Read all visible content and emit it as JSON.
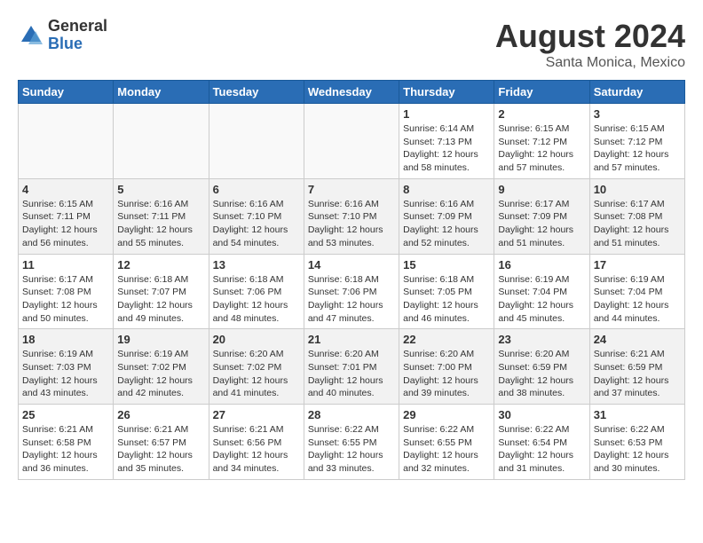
{
  "header": {
    "logo_general": "General",
    "logo_blue": "Blue",
    "title": "August 2024",
    "location": "Santa Monica, Mexico"
  },
  "days_of_week": [
    "Sunday",
    "Monday",
    "Tuesday",
    "Wednesday",
    "Thursday",
    "Friday",
    "Saturday"
  ],
  "weeks": [
    [
      {
        "day": "",
        "text": ""
      },
      {
        "day": "",
        "text": ""
      },
      {
        "day": "",
        "text": ""
      },
      {
        "day": "",
        "text": ""
      },
      {
        "day": "1",
        "text": "Sunrise: 6:14 AM\nSunset: 7:13 PM\nDaylight: 12 hours\nand 58 minutes."
      },
      {
        "day": "2",
        "text": "Sunrise: 6:15 AM\nSunset: 7:12 PM\nDaylight: 12 hours\nand 57 minutes."
      },
      {
        "day": "3",
        "text": "Sunrise: 6:15 AM\nSunset: 7:12 PM\nDaylight: 12 hours\nand 57 minutes."
      }
    ],
    [
      {
        "day": "4",
        "text": "Sunrise: 6:15 AM\nSunset: 7:11 PM\nDaylight: 12 hours\nand 56 minutes."
      },
      {
        "day": "5",
        "text": "Sunrise: 6:16 AM\nSunset: 7:11 PM\nDaylight: 12 hours\nand 55 minutes."
      },
      {
        "day": "6",
        "text": "Sunrise: 6:16 AM\nSunset: 7:10 PM\nDaylight: 12 hours\nand 54 minutes."
      },
      {
        "day": "7",
        "text": "Sunrise: 6:16 AM\nSunset: 7:10 PM\nDaylight: 12 hours\nand 53 minutes."
      },
      {
        "day": "8",
        "text": "Sunrise: 6:16 AM\nSunset: 7:09 PM\nDaylight: 12 hours\nand 52 minutes."
      },
      {
        "day": "9",
        "text": "Sunrise: 6:17 AM\nSunset: 7:09 PM\nDaylight: 12 hours\nand 51 minutes."
      },
      {
        "day": "10",
        "text": "Sunrise: 6:17 AM\nSunset: 7:08 PM\nDaylight: 12 hours\nand 51 minutes."
      }
    ],
    [
      {
        "day": "11",
        "text": "Sunrise: 6:17 AM\nSunset: 7:08 PM\nDaylight: 12 hours\nand 50 minutes."
      },
      {
        "day": "12",
        "text": "Sunrise: 6:18 AM\nSunset: 7:07 PM\nDaylight: 12 hours\nand 49 minutes."
      },
      {
        "day": "13",
        "text": "Sunrise: 6:18 AM\nSunset: 7:06 PM\nDaylight: 12 hours\nand 48 minutes."
      },
      {
        "day": "14",
        "text": "Sunrise: 6:18 AM\nSunset: 7:06 PM\nDaylight: 12 hours\nand 47 minutes."
      },
      {
        "day": "15",
        "text": "Sunrise: 6:18 AM\nSunset: 7:05 PM\nDaylight: 12 hours\nand 46 minutes."
      },
      {
        "day": "16",
        "text": "Sunrise: 6:19 AM\nSunset: 7:04 PM\nDaylight: 12 hours\nand 45 minutes."
      },
      {
        "day": "17",
        "text": "Sunrise: 6:19 AM\nSunset: 7:04 PM\nDaylight: 12 hours\nand 44 minutes."
      }
    ],
    [
      {
        "day": "18",
        "text": "Sunrise: 6:19 AM\nSunset: 7:03 PM\nDaylight: 12 hours\nand 43 minutes."
      },
      {
        "day": "19",
        "text": "Sunrise: 6:19 AM\nSunset: 7:02 PM\nDaylight: 12 hours\nand 42 minutes."
      },
      {
        "day": "20",
        "text": "Sunrise: 6:20 AM\nSunset: 7:02 PM\nDaylight: 12 hours\nand 41 minutes."
      },
      {
        "day": "21",
        "text": "Sunrise: 6:20 AM\nSunset: 7:01 PM\nDaylight: 12 hours\nand 40 minutes."
      },
      {
        "day": "22",
        "text": "Sunrise: 6:20 AM\nSunset: 7:00 PM\nDaylight: 12 hours\nand 39 minutes."
      },
      {
        "day": "23",
        "text": "Sunrise: 6:20 AM\nSunset: 6:59 PM\nDaylight: 12 hours\nand 38 minutes."
      },
      {
        "day": "24",
        "text": "Sunrise: 6:21 AM\nSunset: 6:59 PM\nDaylight: 12 hours\nand 37 minutes."
      }
    ],
    [
      {
        "day": "25",
        "text": "Sunrise: 6:21 AM\nSunset: 6:58 PM\nDaylight: 12 hours\nand 36 minutes."
      },
      {
        "day": "26",
        "text": "Sunrise: 6:21 AM\nSunset: 6:57 PM\nDaylight: 12 hours\nand 35 minutes."
      },
      {
        "day": "27",
        "text": "Sunrise: 6:21 AM\nSunset: 6:56 PM\nDaylight: 12 hours\nand 34 minutes."
      },
      {
        "day": "28",
        "text": "Sunrise: 6:22 AM\nSunset: 6:55 PM\nDaylight: 12 hours\nand 33 minutes."
      },
      {
        "day": "29",
        "text": "Sunrise: 6:22 AM\nSunset: 6:55 PM\nDaylight: 12 hours\nand 32 minutes."
      },
      {
        "day": "30",
        "text": "Sunrise: 6:22 AM\nSunset: 6:54 PM\nDaylight: 12 hours\nand 31 minutes."
      },
      {
        "day": "31",
        "text": "Sunrise: 6:22 AM\nSunset: 6:53 PM\nDaylight: 12 hours\nand 30 minutes."
      }
    ]
  ]
}
